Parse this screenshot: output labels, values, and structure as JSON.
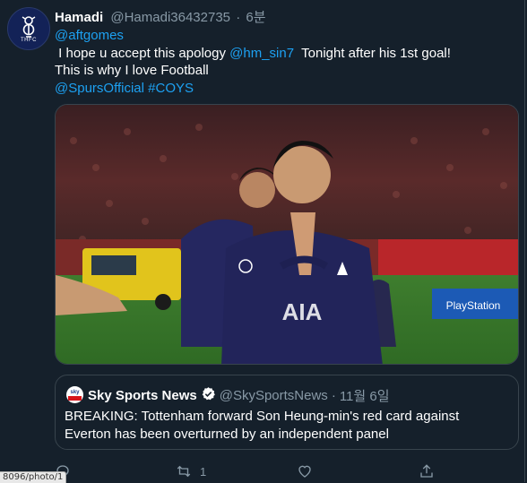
{
  "tweet": {
    "display_name": "Hamadi",
    "handle": "@Hamadi36432735",
    "separator": "·",
    "time": "6분",
    "avatar_label": "THFC",
    "reply_to": "@aftgomes",
    "line1_before": " I hope u accept this apology ",
    "line1_mention": "@hm_sin7",
    "line1_after": "  Tonight after his 1st goal!",
    "line2": "This is why I love Football",
    "line3_mention": "@SpursOfficial",
    "line3_hashtag": "#COYS",
    "media": {
      "board_text_left": "AIA",
      "board_text_right": "PlayStation"
    }
  },
  "quote": {
    "avatar_text": "sky",
    "display_name": "Sky Sports News",
    "handle": "@SkySportsNews",
    "separator": "·",
    "time": "11월 6일",
    "text_line1": "BREAKING: Tottenham forward Son Heung-min's red card against",
    "text_line2": "Everton has been overturned by an independent panel"
  },
  "actions": {
    "reply_icon": "reply-icon",
    "retweet_icon": "retweet-icon",
    "retweet_count": "1",
    "like_icon": "like-icon",
    "share_icon": "share-icon"
  },
  "status_url": "8096/photo/1",
  "colors": {
    "background": "#15202b",
    "link": "#1da1f2",
    "secondary_text": "#8899a6",
    "border": "#38444d"
  }
}
